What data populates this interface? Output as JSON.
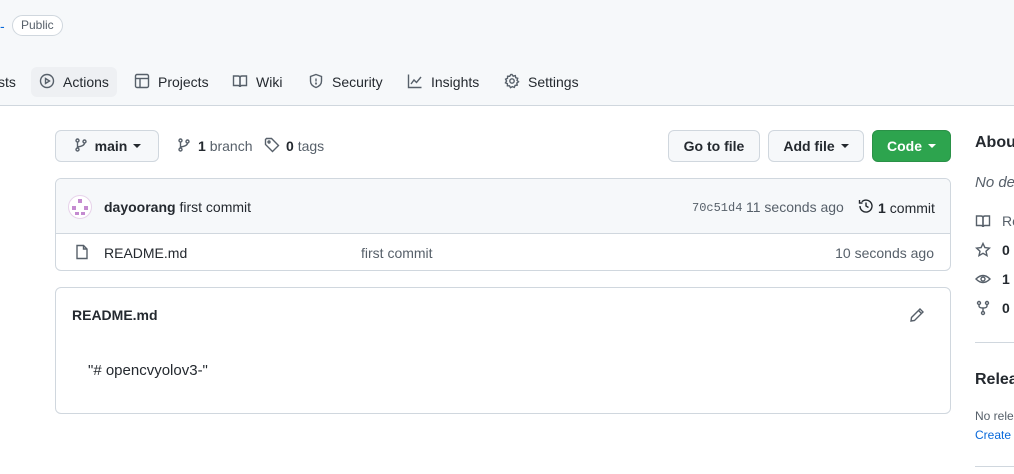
{
  "header": {
    "dash": "-",
    "visibility_badge": "Public"
  },
  "tabs": [
    {
      "label": "sts",
      "icon": "pull-request-icon"
    },
    {
      "label": "Actions",
      "icon": "play-icon"
    },
    {
      "label": "Projects",
      "icon": "table-icon"
    },
    {
      "label": "Wiki",
      "icon": "book-icon"
    },
    {
      "label": "Security",
      "icon": "shield-icon"
    },
    {
      "label": "Insights",
      "icon": "graph-icon"
    },
    {
      "label": "Settings",
      "icon": "gear-icon"
    }
  ],
  "toolbar": {
    "branch_selector": "main",
    "branch_count": "1",
    "branch_label": "branch",
    "tag_count": "0",
    "tag_label": "tags",
    "go_to_file": "Go to file",
    "add_file": "Add file",
    "code": "Code"
  },
  "commit": {
    "author": "dayoorang",
    "message": "first commit",
    "hash": "70c51d4",
    "time": "11 seconds ago",
    "count": "1",
    "count_label": "commit"
  },
  "files": [
    {
      "name": "README.md",
      "message": "first commit",
      "time": "10 seconds ago"
    }
  ],
  "readme": {
    "title": "README.md",
    "content": "\"# opencvyolov3-\""
  },
  "sidebar": {
    "about_title": "Abou",
    "description": "No de",
    "readme_label": "Re",
    "stars": "0",
    "watchers": "1",
    "forks": "0",
    "releases_title": "Relea",
    "no_releases": "No rele",
    "create_release": "Create a"
  },
  "colors": {
    "accent_link": "#0969da",
    "green_button": "#2da44e",
    "border": "#d0d7de",
    "header_bg": "#f6f8fa"
  }
}
